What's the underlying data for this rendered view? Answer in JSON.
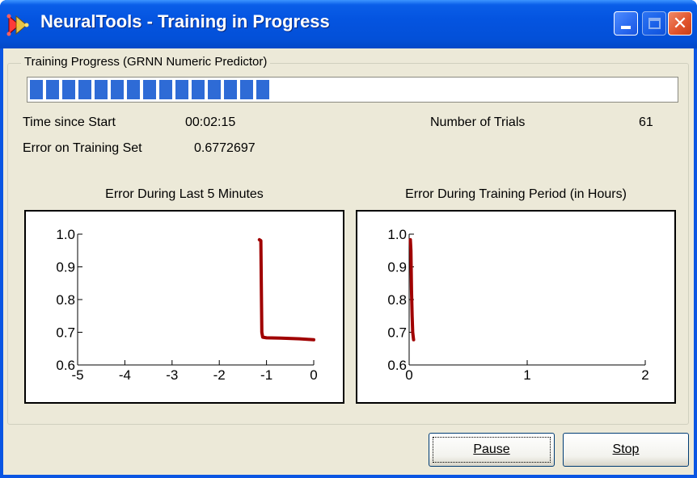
{
  "window": {
    "title": "NeuralTools - Training in Progress",
    "icon": "neuraltools-app-icon",
    "controls": [
      "minimize",
      "maximize",
      "close"
    ]
  },
  "group": {
    "legend": "Training Progress (GRNN Numeric Predictor)"
  },
  "progress": {
    "segments_filled": 15,
    "fraction": 0.38,
    "color": "#2e6bd6"
  },
  "stats": {
    "time_label": "Time since Start",
    "time_value": "00:02:15",
    "error_label": "Error on Training Set",
    "error_value": "0.6772697",
    "trials_label": "Number of Trials",
    "trials_value": "61"
  },
  "chart_data": [
    {
      "type": "line",
      "title": "Error During Last 5 Minutes",
      "xlim": [
        -5,
        0
      ],
      "ylim": [
        0.6,
        1.0
      ],
      "xticks": [
        "-5",
        "-4",
        "-3",
        "-2",
        "-1",
        "0"
      ],
      "yticks": [
        "0.6",
        "0.7",
        "0.8",
        "0.9",
        "1.0"
      ],
      "series": [
        {
          "color": "#a00000",
          "x": [
            -1.15,
            -1.12,
            -1.1,
            -1.08,
            -1.0,
            -0.7,
            -0.3,
            -0.1,
            0.0
          ],
          "y": [
            0.983,
            0.98,
            0.7,
            0.685,
            0.683,
            0.682,
            0.68,
            0.678,
            0.677
          ]
        }
      ]
    },
    {
      "type": "line",
      "title": "Error During Training Period (in Hours)",
      "xlim": [
        0,
        2
      ],
      "ylim": [
        0.6,
        1.0
      ],
      "xticks": [
        "0",
        "1",
        "2"
      ],
      "yticks": [
        "0.6",
        "0.7",
        "0.8",
        "0.9",
        "1.0"
      ],
      "series": [
        {
          "color": "#a00000",
          "x": [
            0.01,
            0.015,
            0.02,
            0.025,
            0.03,
            0.035,
            0.038
          ],
          "y": [
            0.983,
            0.95,
            0.83,
            0.75,
            0.7,
            0.685,
            0.677
          ]
        }
      ]
    }
  ],
  "buttons": {
    "pause_label": "Pause",
    "stop_label": "Stop"
  }
}
